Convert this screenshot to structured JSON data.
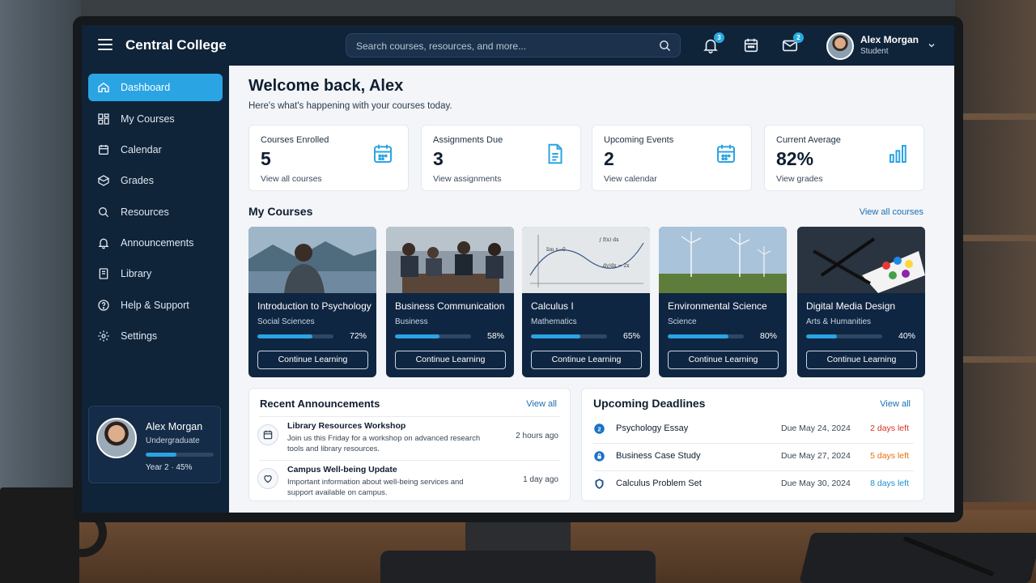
{
  "app": {
    "brand": "Central College"
  },
  "search": {
    "placeholder": "Search courses, resources, and more..."
  },
  "topbar": {
    "notifications_badge": "3",
    "messages_badge": "2",
    "user_name": "Alex Morgan",
    "user_role": "Student"
  },
  "sidebar": {
    "items": [
      {
        "label": "Dashboard",
        "icon": "home-icon",
        "active": true
      },
      {
        "label": "My Courses",
        "icon": "courses-icon"
      },
      {
        "label": "Calendar",
        "icon": "calendar-icon"
      },
      {
        "label": "Grades",
        "icon": "grades-icon"
      },
      {
        "label": "Resources",
        "icon": "search-icon"
      },
      {
        "label": "Announcements",
        "icon": "bell-icon"
      },
      {
        "label": "Library",
        "icon": "library-icon"
      },
      {
        "label": "Help & Support",
        "icon": "help-icon"
      },
      {
        "label": "Settings",
        "icon": "gear-icon"
      }
    ],
    "profile": {
      "name": "Alex Morgan",
      "level": "Undergraduate",
      "year": "Year 2 · 45%",
      "progress": 0.45
    }
  },
  "main": {
    "welcome": "Welcome back, Alex",
    "subtitle": "Here's what's happening with your courses today.",
    "stats": [
      {
        "label": "Courses Enrolled",
        "value": "5",
        "link": "View all courses",
        "icon": "calendar-icon"
      },
      {
        "label": "Assignments Due",
        "value": "3",
        "link": "View assignments",
        "icon": "document-icon"
      },
      {
        "label": "Upcoming Events",
        "value": "2",
        "link": "View calendar",
        "icon": "calendar-icon"
      },
      {
        "label": "Current Average",
        "value": "82%",
        "link": "View grades",
        "icon": "bar-chart-icon"
      }
    ],
    "courses_title": "My Courses",
    "courses_view_all": "View all courses",
    "courses": [
      {
        "title": "Introduction to Psychology",
        "category": "Social Sciences",
        "progress": 72,
        "pct": "72%",
        "button": "Continue Learning"
      },
      {
        "title": "Business Communication",
        "category": "Business",
        "progress": 58,
        "pct": "58%",
        "button": "Continue Learning"
      },
      {
        "title": "Calculus I",
        "category": "Mathematics",
        "progress": 65,
        "pct": "65%",
        "button": "Continue Learning"
      },
      {
        "title": "Environmental Science",
        "category": "Science",
        "progress": 80,
        "pct": "80%",
        "button": "Continue Learning"
      },
      {
        "title": "Digital Media Design",
        "category": "Arts & Humanities",
        "progress": 40,
        "pct": "40%",
        "button": "Continue Learning"
      }
    ],
    "announcements": {
      "title": "Recent Announcements",
      "view_all": "View all",
      "items": [
        {
          "title": "Library Resources Workshop",
          "desc": "Join us this Friday for a workshop on advanced research tools and library resources.",
          "time": "2 hours ago",
          "icon": "calendar-icon"
        },
        {
          "title": "Campus Well-being Update",
          "desc": "Important information about well-being services and support available on campus.",
          "time": "1 day ago",
          "icon": "heart-icon"
        }
      ]
    },
    "deadlines": {
      "title": "Upcoming Deadlines",
      "view_all": "View all",
      "items": [
        {
          "name": "Psychology Essay",
          "due": "Due May 24, 2024",
          "left": "2 days left",
          "color": "#d93025",
          "icon_mark": "2"
        },
        {
          "name": "Business Case Study",
          "due": "Due May 27, 2024",
          "left": "5 days left",
          "color": "#e8710a",
          "icon_mark": ""
        },
        {
          "name": "Calculus Problem Set",
          "due": "Due May 30, 2024",
          "left": "8 days left",
          "color": "#1a8fcf",
          "icon_mark": ""
        }
      ]
    }
  },
  "colors": {
    "accent": "#2ba4e3",
    "nav_bg": "#0f2339",
    "card_bg": "#0f2642"
  }
}
